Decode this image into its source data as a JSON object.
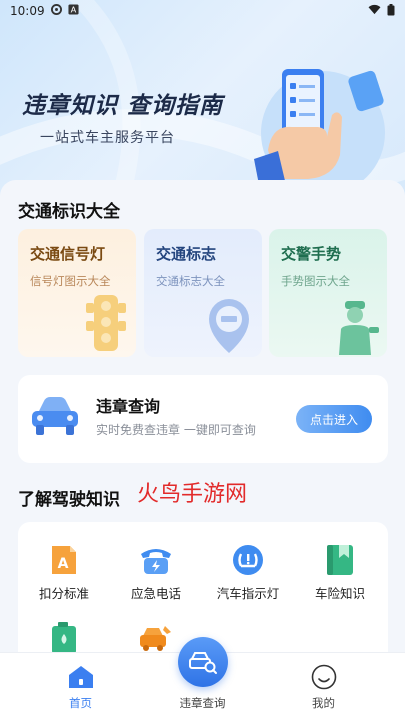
{
  "status_bar": {
    "time": "10:09"
  },
  "hero": {
    "title": "违章知识 查询指南",
    "subtitle": "一站式车主服务平台"
  },
  "traffic_signs": {
    "title": "交通标识大全",
    "cards": [
      {
        "title": "交通信号灯",
        "subtitle": "信号灯图示大全"
      },
      {
        "title": "交通标志",
        "subtitle": "交通标志大全"
      },
      {
        "title": "交警手势",
        "subtitle": "手势图示大全"
      }
    ]
  },
  "violation_query": {
    "title": "违章查询",
    "subtitle": "实时免费查违章 一键即可查询",
    "button_label": "点击进入"
  },
  "driving_knowledge": {
    "title": "了解驾驶知识",
    "watermark": "火鸟手游网",
    "items": [
      {
        "label": "扣分标准",
        "icon": "document-a-icon"
      },
      {
        "label": "应急电话",
        "icon": "telephone-icon"
      },
      {
        "label": "汽车指示灯",
        "icon": "tire-pressure-icon"
      },
      {
        "label": "车险知识",
        "icon": "bookmark-book-icon"
      },
      {
        "label": "",
        "icon": "fuel-can-icon"
      },
      {
        "label": "",
        "icon": "car-repair-icon"
      }
    ]
  },
  "tab_bar": {
    "tabs": [
      {
        "label": "首页",
        "icon": "home-icon",
        "active": true
      },
      {
        "label": "违章查询",
        "icon": "car-search-icon",
        "active": false
      },
      {
        "label": "我的",
        "icon": "smiley-icon",
        "active": false
      }
    ]
  },
  "colors": {
    "accent": "#3b7ff0",
    "watermark": "#e22a2a"
  }
}
